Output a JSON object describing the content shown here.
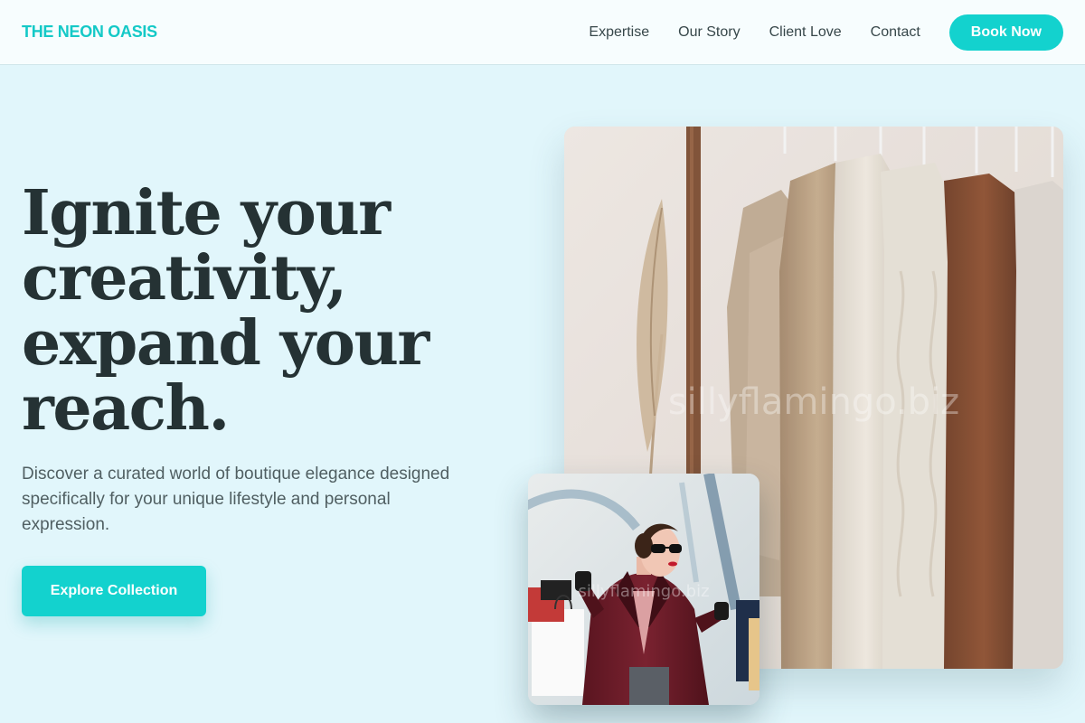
{
  "brand": {
    "name": "THE NEON OASIS"
  },
  "nav": {
    "links": [
      "Expertise",
      "Our Story",
      "Client Love",
      "Contact"
    ],
    "book_label": "Book Now"
  },
  "hero": {
    "title_lines": [
      "Ignite your",
      "creativity,",
      "expand your",
      "reach."
    ],
    "subtitle": "Discover a curated world of boutique elegance designed specifically for your unique lifestyle and personal expression.",
    "cta_label": "Explore Collection"
  },
  "images": {
    "main_watermark": "sillyflamingo.biz",
    "small_watermark": "sillyflamingo.biz"
  },
  "colors": {
    "accent": "#13d2ce",
    "page_bg": "#e1f6fb",
    "header_bg": "#f7fdfe",
    "heading": "#253234"
  }
}
